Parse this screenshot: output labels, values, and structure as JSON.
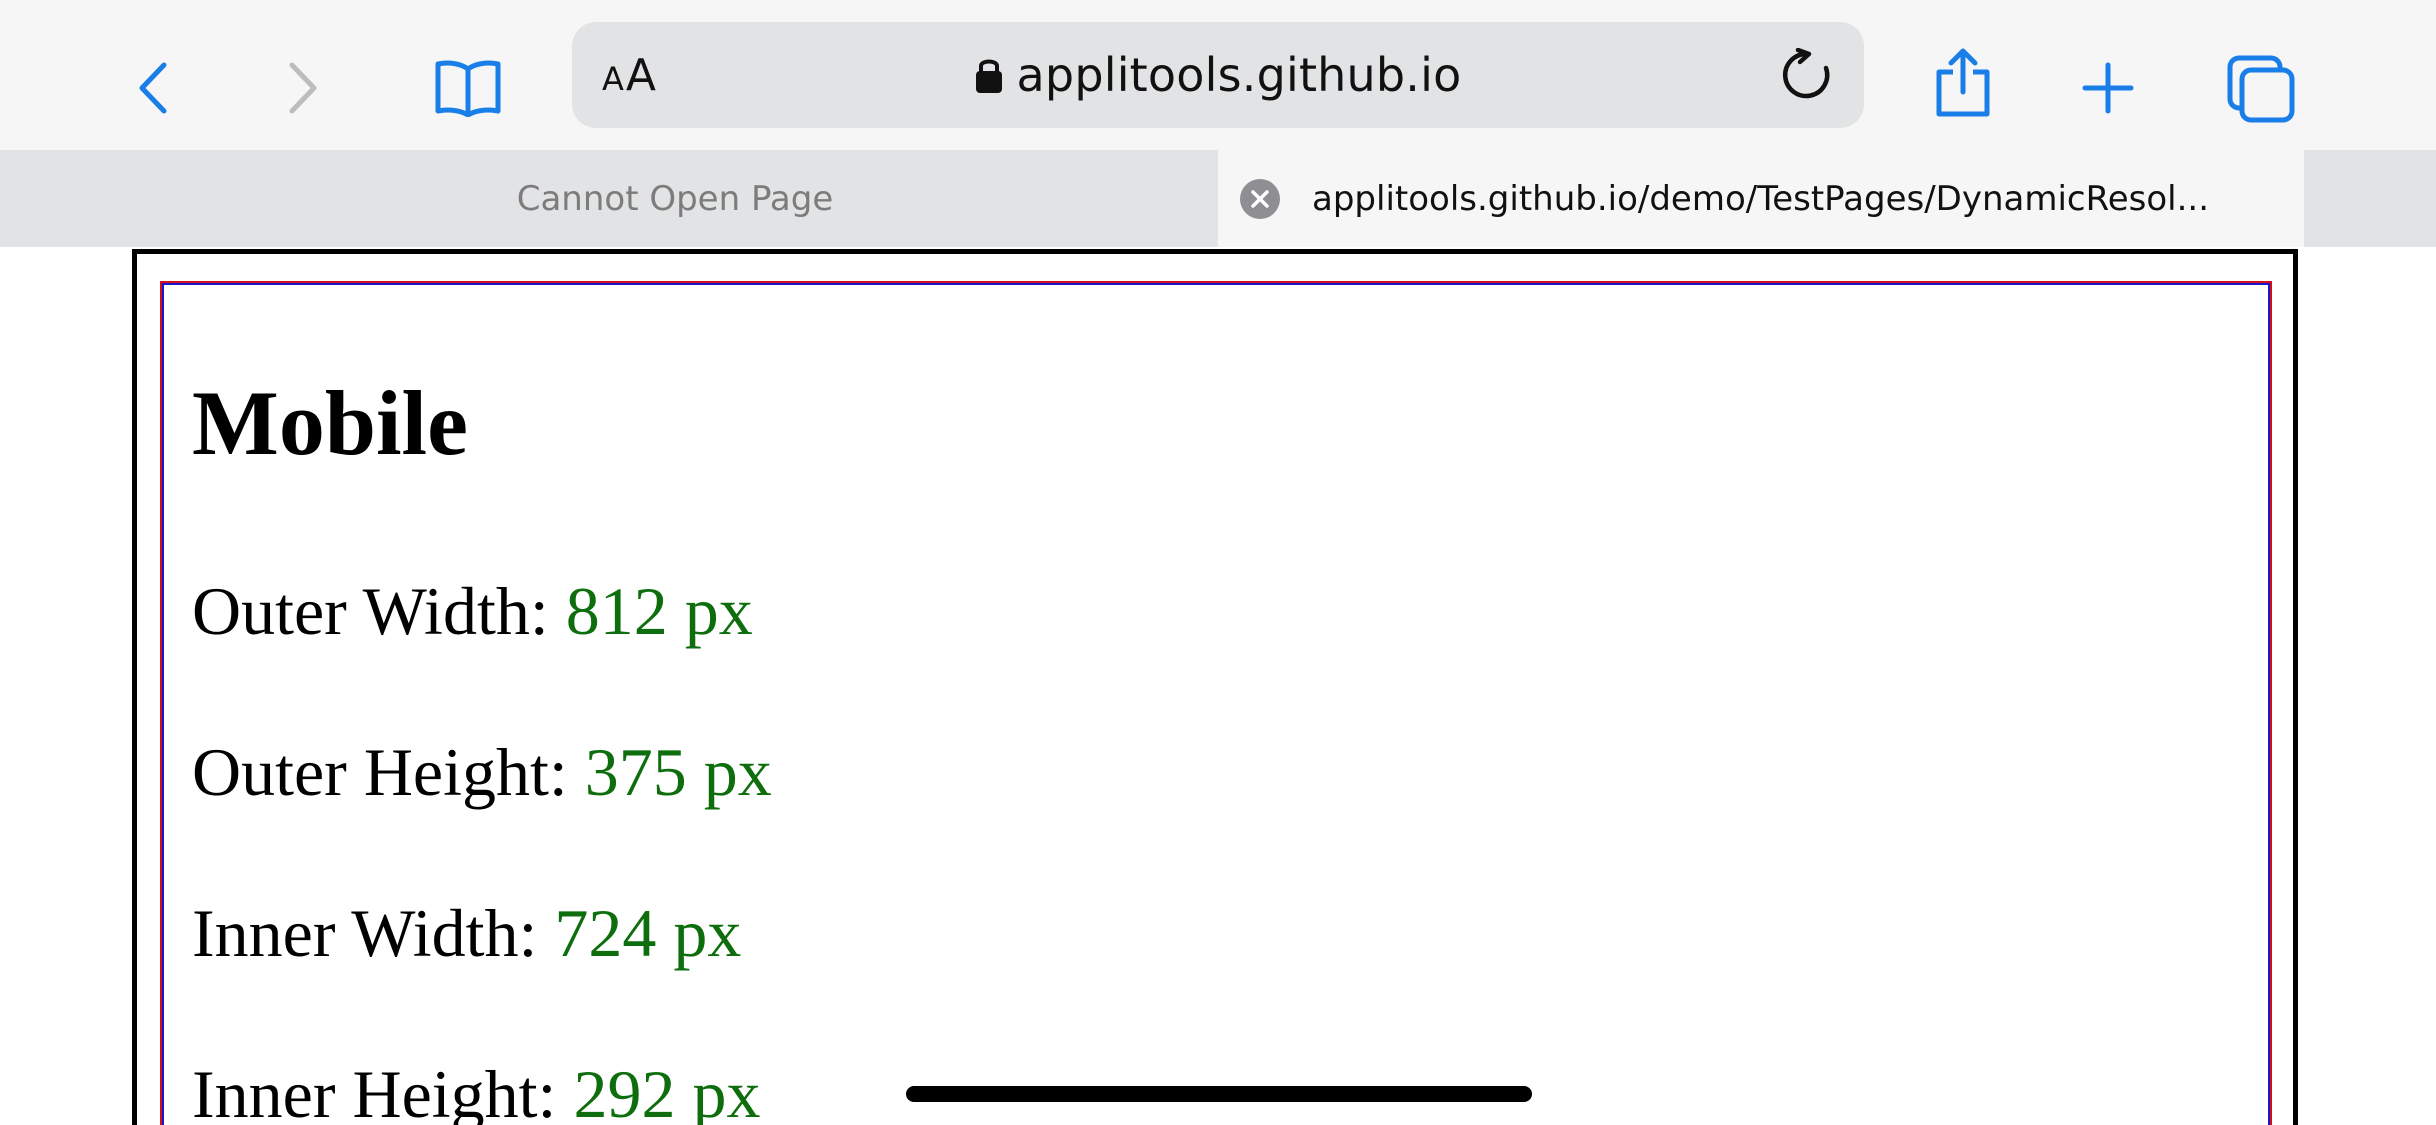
{
  "browser": {
    "url": "applitools.github.io",
    "reader_label_small": "A",
    "reader_label_large": "A",
    "accent_color": "#1a7ee8",
    "tabs": [
      {
        "label": "Cannot Open Page",
        "active": false
      },
      {
        "label": "applitools.github.io/demo/TestPages/DynamicResol...",
        "active": true
      }
    ],
    "icons": [
      "back-icon",
      "forward-icon",
      "bookmarks-icon",
      "lock-icon",
      "reload-icon",
      "share-icon",
      "new-tab-icon",
      "tabs-overview-icon",
      "tab-close-icon"
    ]
  },
  "page": {
    "heading": "Mobile",
    "metrics": [
      {
        "label": "Outer Width: ",
        "value": "812 px"
      },
      {
        "label": "Outer Height: ",
        "value": "375 px"
      },
      {
        "label": "Inner Width: ",
        "value": "724 px"
      },
      {
        "label": "Inner Height: ",
        "value": "292 px"
      }
    ],
    "value_color": "#0e6e0e",
    "frame_colors": {
      "outer": "#000000",
      "inner_red": "#d0101a",
      "inner_blue": "#1a16c8"
    }
  }
}
